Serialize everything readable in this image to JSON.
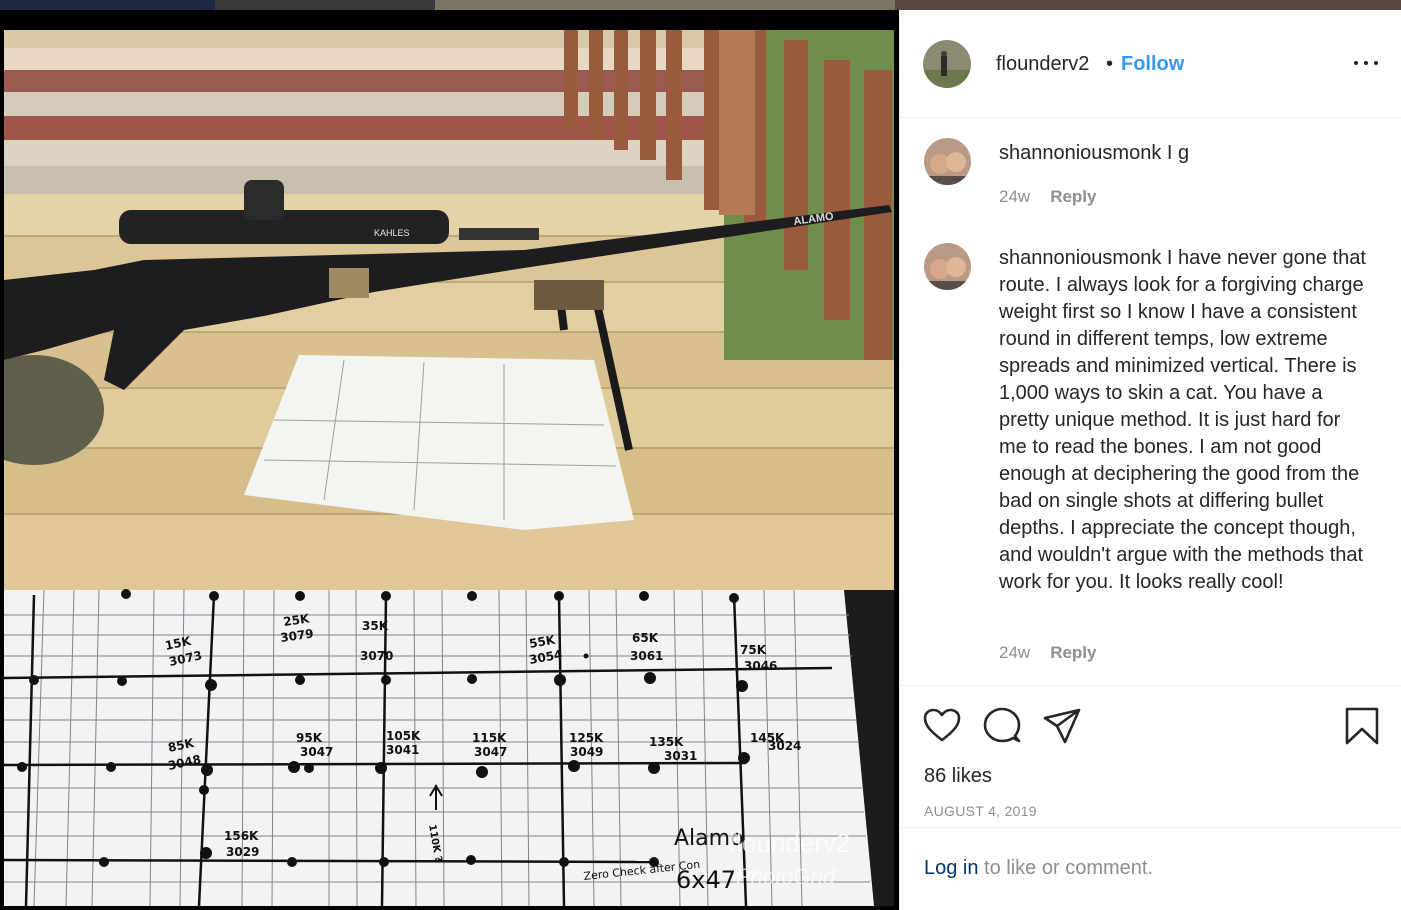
{
  "post": {
    "username": "flounderv2",
    "separator": "•",
    "follow_label": "Follow",
    "more_icon": "more-options-icon",
    "likes": "86 likes",
    "date": "AUGUST 4, 2019",
    "login_link": "Log in",
    "login_suffix": " to like or comment."
  },
  "comments": [
    {
      "username": "shannoniousmonk",
      "text": " I g",
      "age": "24w",
      "reply_label": "Reply"
    },
    {
      "username": "shannoniousmonk",
      "text": " I have never gone that route. I always look for a forgiving charge weight first so I know I have a consistent round in different temps, low extreme spreads and minimized vertical. There is 1,000 ways to skin a cat. You have a pretty unique method. It is just hard for me to read the bones. I am not good enough at deciphering the good from the bad on single shots at differing bullet depths. I appreciate the concept though, and wouldn't argue with the methods that work for you. It looks really cool!",
      "age": "24w",
      "reply_label": "Reply"
    }
  ],
  "photo": {
    "rifle_brand_text": "ALAMO",
    "scope_brand_text": "KAHLES",
    "watermark_name": "flounderv2",
    "watermark_app": "PhotoGrid",
    "target_labels": [
      {
        "load": "15K",
        "speed": "3073"
      },
      {
        "load": "25K",
        "speed": "3079"
      },
      {
        "load": "35K",
        "speed": "3070"
      },
      {
        "load": "55K",
        "speed": "3054"
      },
      {
        "load": "65K",
        "speed": "3061"
      },
      {
        "load": "75K",
        "speed": "3046"
      },
      {
        "load": "85K",
        "speed": "3048"
      },
      {
        "load": "95K",
        "speed": "3047"
      },
      {
        "load": "105K",
        "speed": "3041"
      },
      {
        "load": "115K",
        "speed": "3047"
      },
      {
        "load": "125K",
        "speed": "3049"
      },
      {
        "load": "135K",
        "speed": "3031"
      },
      {
        "load": "145K",
        "speed": "3024"
      },
      {
        "load": "156K",
        "speed": "3029"
      }
    ],
    "note_110": "110K ?",
    "note_alamo": "Alamo",
    "note_cal": "6x47",
    "note_zero": "Zero Check after Con"
  },
  "colors": {
    "link_blue": "#3897f0",
    "text": "#262626",
    "muted": "#8e8e8e",
    "border": "#efefef"
  }
}
